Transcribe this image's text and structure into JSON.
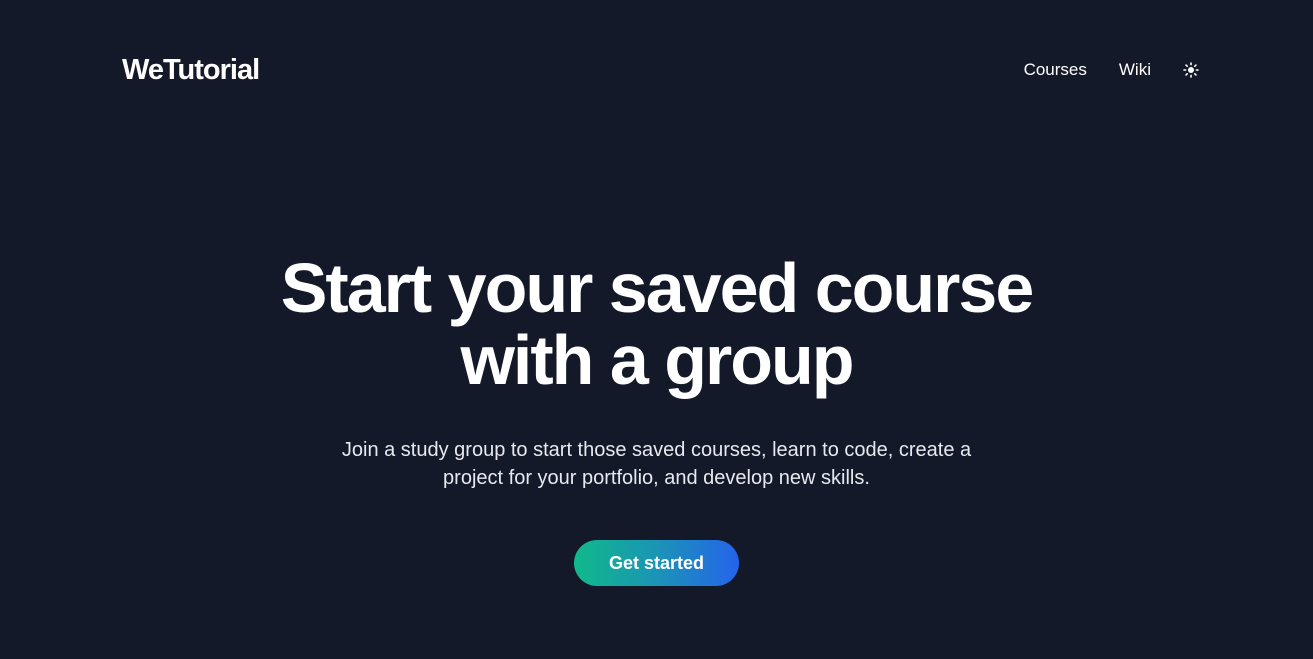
{
  "header": {
    "logo": "WeTutorial",
    "nav": {
      "courses": "Courses",
      "wiki": "Wiki"
    },
    "theme_toggle_icon": "sun-icon"
  },
  "hero": {
    "title": "Start your saved course with a group",
    "subtitle": "Join a study group to start those saved courses, learn to code, create a project for your portfolio, and develop new skills.",
    "cta_label": "Get started"
  },
  "colors": {
    "background": "#131929",
    "text": "#ffffff",
    "cta_gradient_start": "#10b98a",
    "cta_gradient_end": "#2563eb"
  }
}
